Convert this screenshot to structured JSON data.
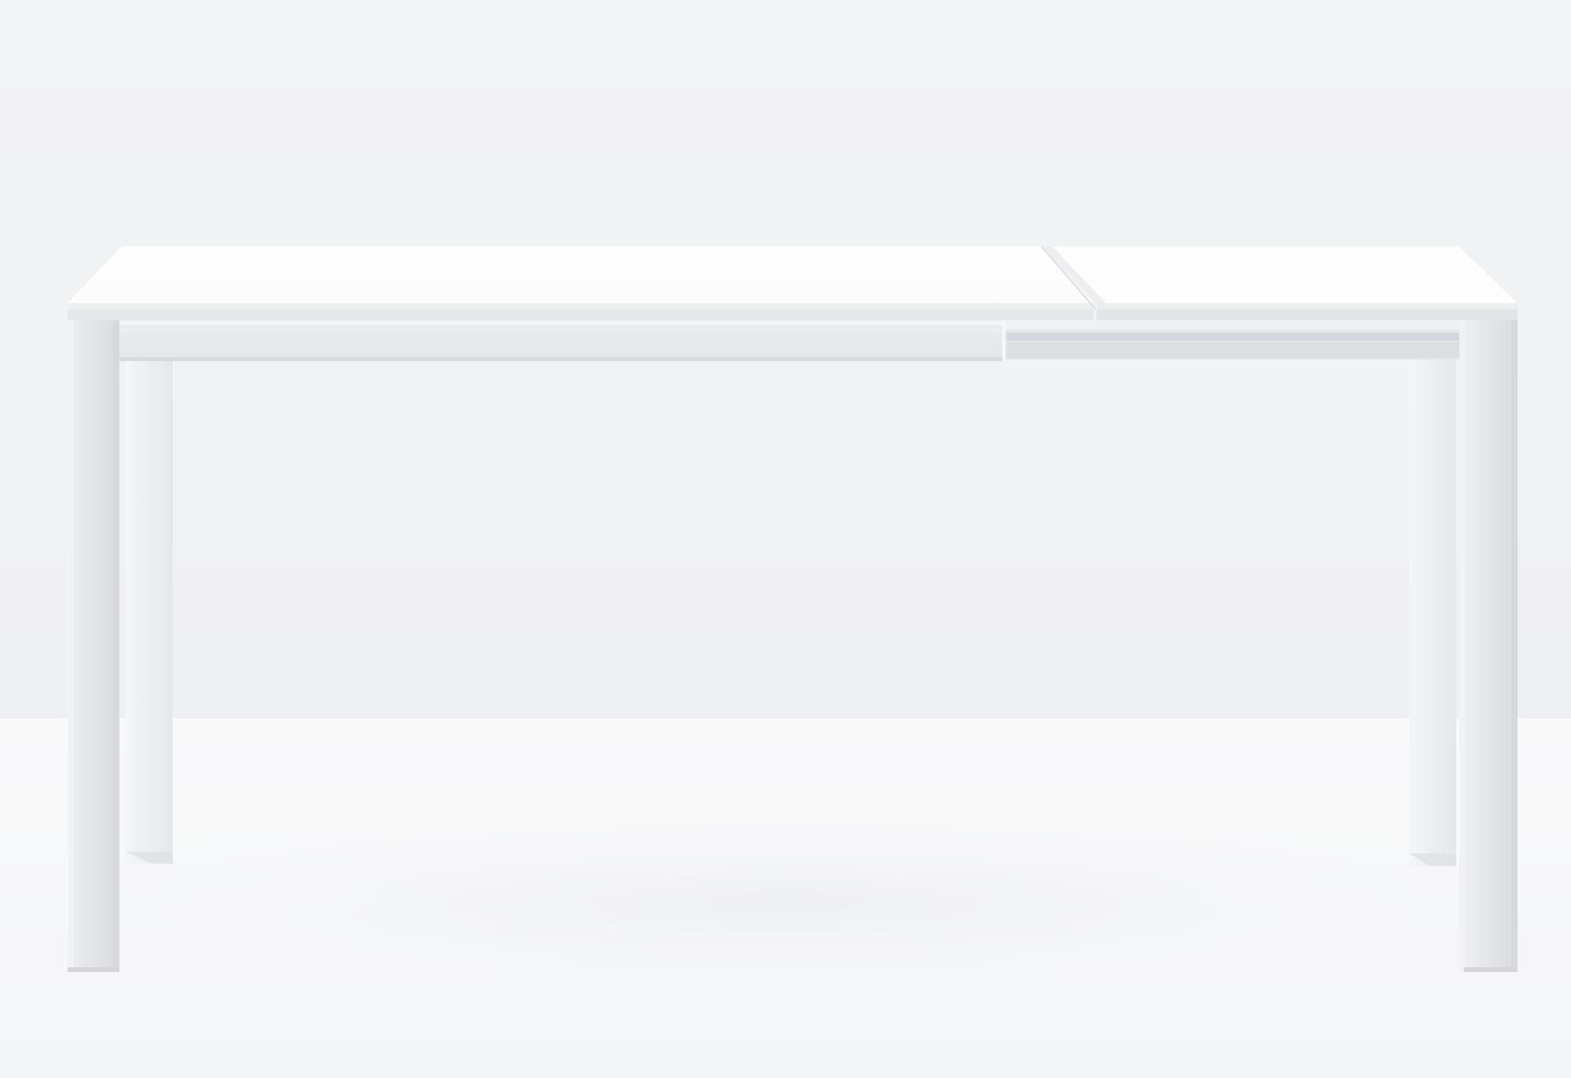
{
  "image": {
    "subject": "extendable-table",
    "colors": {
      "wall": "#f1f2f4",
      "floor": "#f7f8f9",
      "tabletop": "#ffffff",
      "tabletop_edge": "#e9eaec",
      "frame": "#e6e7ea",
      "frame_shadow": "#d4d6da",
      "leg_front": "#e4e5e8",
      "leg_back": "#f0f1f3",
      "rail": "#d9dbdf"
    }
  }
}
